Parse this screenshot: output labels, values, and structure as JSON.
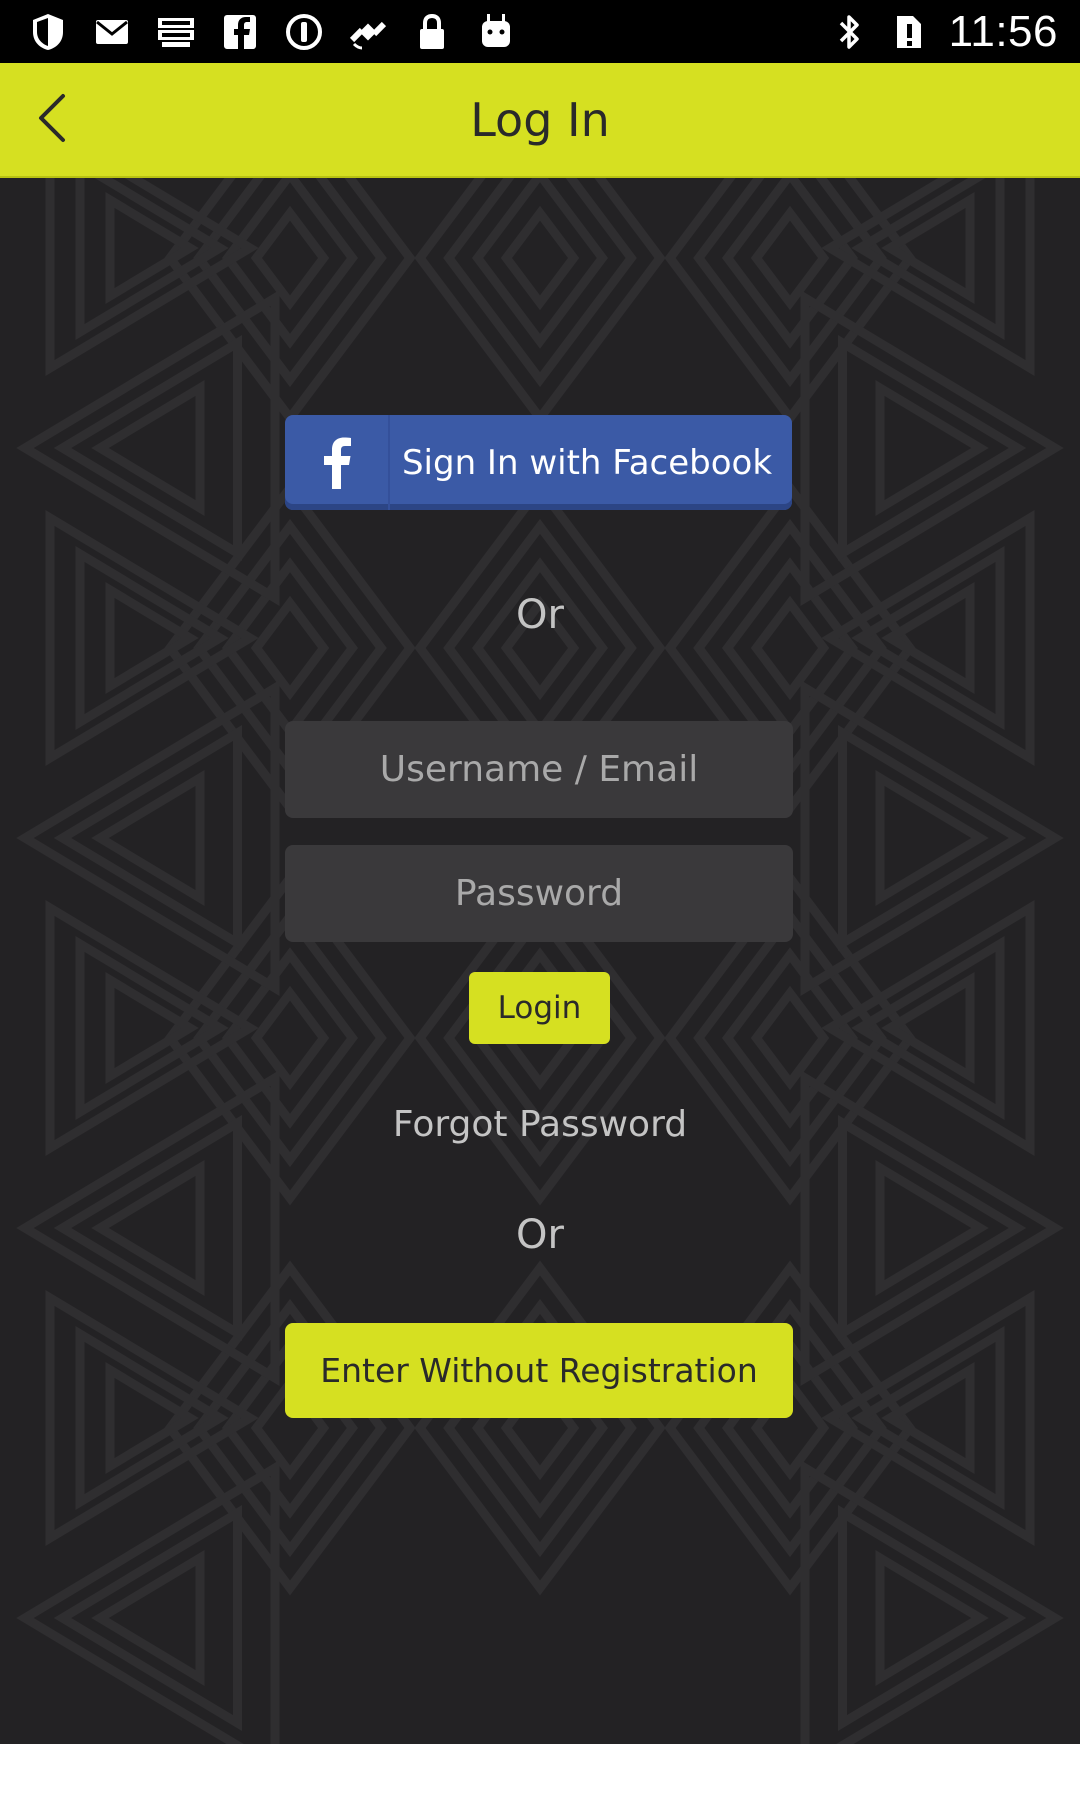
{
  "status_bar": {
    "time": "11:56",
    "left_icons": [
      "shield-icon",
      "mail-icon",
      "espn-dallas-icon",
      "facebook-icon",
      "circle-info-icon",
      "satellite-icon",
      "lock-icon",
      "android-icon"
    ],
    "right_icons": [
      "bluetooth-icon",
      "no-sim-icon"
    ]
  },
  "app_bar": {
    "title": "Log In",
    "background_color": "#d6e021"
  },
  "main": {
    "facebook_button_label": "Sign In with Facebook",
    "or_top": "Or",
    "username_placeholder": "Username / Email",
    "username_value": "",
    "password_placeholder": "Password",
    "password_value": "",
    "login_button_label": "Login",
    "forgot_password_label": "Forgot Password",
    "or_bottom": "Or",
    "guest_button_label": "Enter Without Registration"
  },
  "colors": {
    "accent": "#d6e021",
    "facebook": "#3b5aa6",
    "background": "#232224",
    "input_background": "#3a393b"
  }
}
